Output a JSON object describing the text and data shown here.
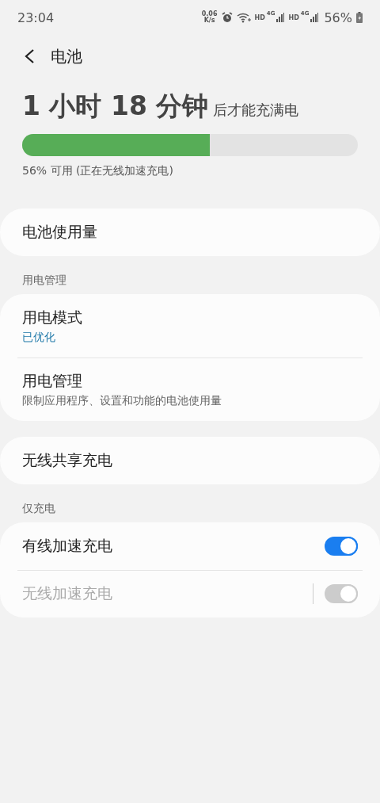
{
  "status_bar": {
    "time": "23:04",
    "net_speed": "0.06",
    "net_unit": "K/s",
    "sims": [
      {
        "hd": "HD",
        "network": "4G"
      },
      {
        "hd": "HD",
        "network": "4G"
      }
    ],
    "battery": "56%"
  },
  "header": {
    "title": "电池"
  },
  "summary": {
    "time": "1 小时 18 分钟",
    "suffix": "后才能充满电",
    "level": 0.56,
    "status": "56% 可用 (正在无线加速充电)"
  },
  "groups": [
    {
      "items": [
        {
          "kind": "link",
          "title": "电池使用量"
        }
      ]
    },
    {
      "heading": "用电管理",
      "items": [
        {
          "kind": "link",
          "title": "用电模式",
          "subtitle": "已优化",
          "accent": true
        },
        {
          "kind": "link",
          "title": "用电管理",
          "subtitle": "限制应用程序、设置和功能的电池使用量",
          "accent": false
        }
      ]
    },
    {
      "items": [
        {
          "kind": "link",
          "title": "无线共享充电"
        }
      ]
    },
    {
      "heading": "仅充电",
      "items": [
        {
          "kind": "toggle",
          "title": "有线加速充电",
          "on": true,
          "disabled": false,
          "split": false
        },
        {
          "kind": "toggle",
          "title": "无线加速充电",
          "on": true,
          "disabled": true,
          "split": true
        }
      ]
    }
  ]
}
